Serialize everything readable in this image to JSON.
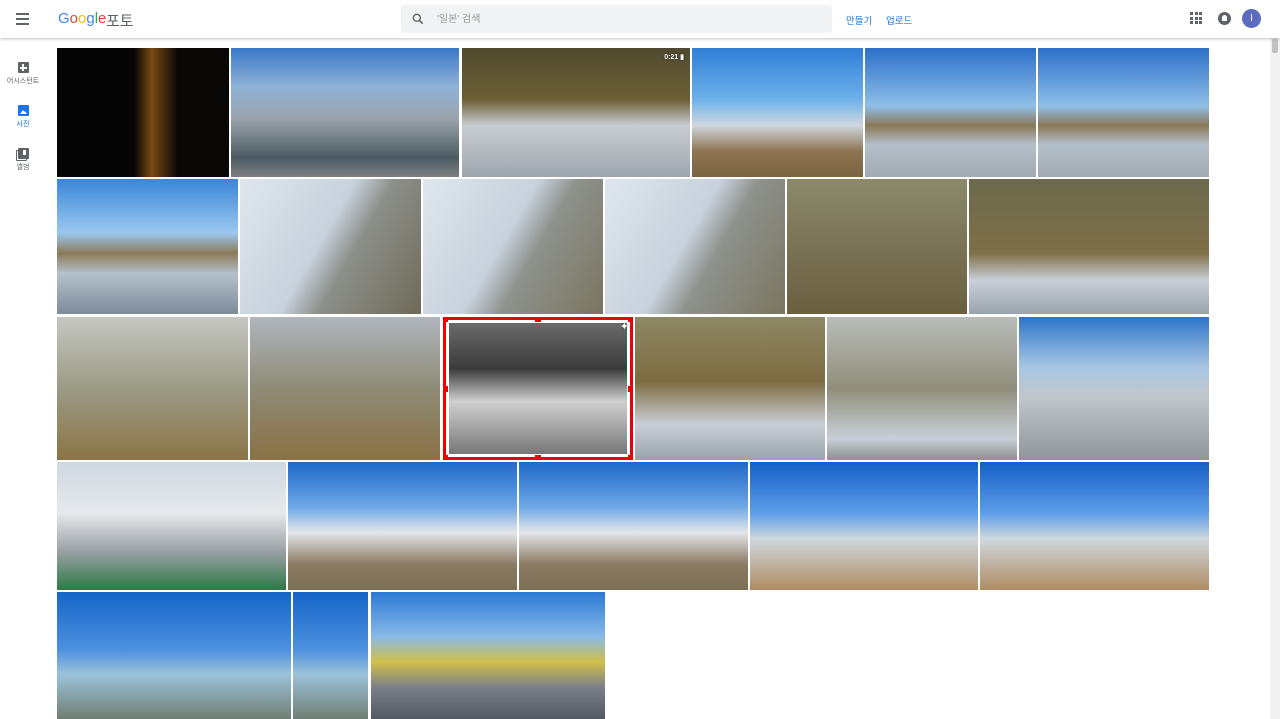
{
  "header": {
    "logo": {
      "G": "G",
      "o1": "o",
      "o2": "o",
      "g": "g",
      "l": "l",
      "e": "e"
    },
    "product": "포토",
    "search_placeholder": "'일본' 검색",
    "links": {
      "create": "만들기",
      "upload": "업로드"
    },
    "avatar_letter": "I"
  },
  "sidebar": {
    "items": [
      {
        "label": "어시스턴트",
        "icon": "assistant-icon"
      },
      {
        "label": "사진",
        "icon": "photo-icon",
        "active": true
      },
      {
        "label": "앨범",
        "icon": "album-icon"
      }
    ]
  },
  "photos": [
    {
      "desc": "dark door",
      "video_duration": ""
    },
    {
      "desc": "building",
      "video_duration": ""
    },
    {
      "desc": "rocks and ice",
      "video_duration": "0:21"
    },
    {
      "desc": "station",
      "video_duration": ""
    },
    {
      "desc": "apartments over ice",
      "video_duration": ""
    },
    {
      "desc": "apartments over ice",
      "video_duration": ""
    },
    {
      "desc": "apartments frozen pond",
      "video_duration": ""
    },
    {
      "desc": "ice edge",
      "video_duration": ""
    },
    {
      "desc": "ice edge",
      "video_duration": ""
    },
    {
      "desc": "ice edge",
      "video_duration": ""
    },
    {
      "desc": "grass in water",
      "video_duration": ""
    },
    {
      "desc": "rocks water",
      "video_duration": ""
    },
    {
      "desc": "ice water",
      "video_duration": ""
    },
    {
      "desc": "ice water",
      "video_duration": ""
    },
    {
      "desc": "bw rocks",
      "video_duration": "",
      "auto_enhanced": true
    },
    {
      "desc": "rocks water",
      "video_duration": ""
    },
    {
      "desc": "rocks ice",
      "video_duration": ""
    },
    {
      "desc": "station bridge",
      "video_duration": ""
    },
    {
      "desc": "station interior",
      "video_duration": ""
    },
    {
      "desc": "station exterior",
      "video_duration": ""
    },
    {
      "desc": "station exterior",
      "video_duration": ""
    },
    {
      "desc": "glass building",
      "video_duration": ""
    },
    {
      "desc": "glass building",
      "video_duration": ""
    },
    {
      "desc": "tower",
      "video_duration": ""
    },
    {
      "desc": "tower",
      "video_duration": ""
    },
    {
      "desc": "mart",
      "video_duration": ""
    }
  ],
  "colors": {
    "accent": "#1a73e8",
    "selection": "#e00000",
    "avatar": "#5c6bc0"
  }
}
